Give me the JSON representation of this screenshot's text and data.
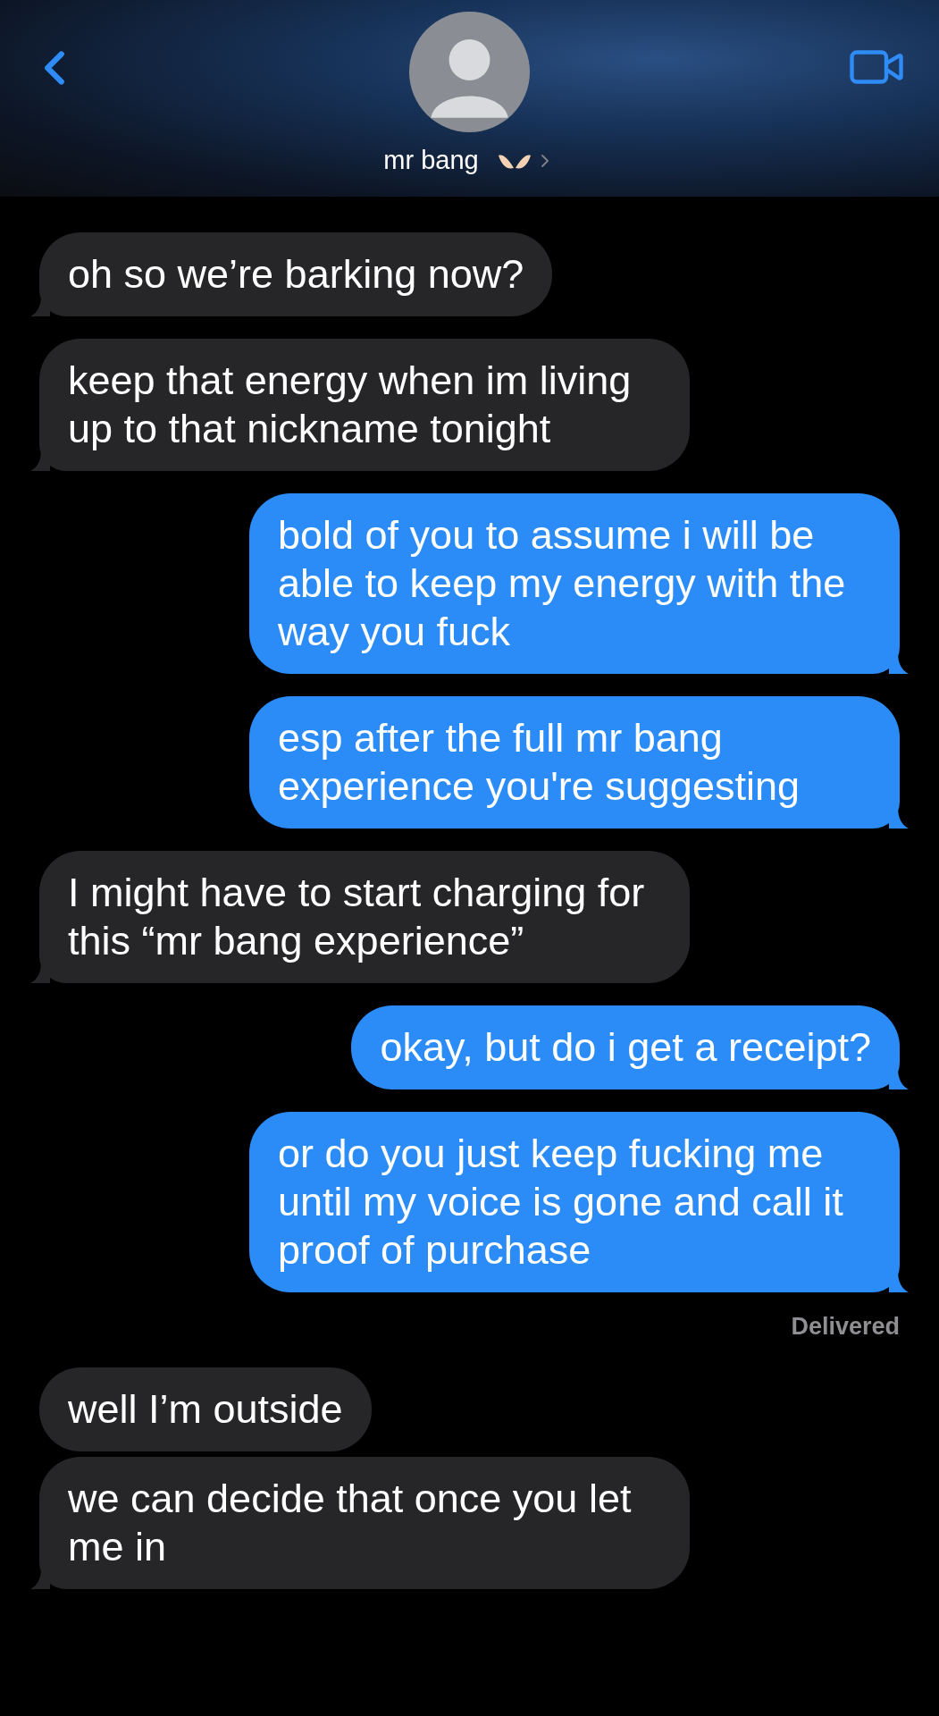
{
  "header": {
    "contact_name": "mr bang"
  },
  "messages": [
    {
      "kind": "incoming",
      "text": "oh so we’re barking now?",
      "tail": true
    },
    {
      "kind": "incoming",
      "text": "keep that energy when im living up to that nickname tonight",
      "tail": true
    },
    {
      "kind": "outgoing",
      "text": "bold of you to assume i will be able to keep my energy with the way you fuck",
      "tail": true
    },
    {
      "kind": "outgoing",
      "text": "esp after the full mr bang experience you're suggesting",
      "tail": true
    },
    {
      "kind": "incoming",
      "text": "I might have to start charging for this “mr bang experience”",
      "tail": true
    },
    {
      "kind": "outgoing",
      "text": "okay, but do i get a receipt?",
      "tail": true
    },
    {
      "kind": "outgoing",
      "text": "or do you just keep fucking me until my voice is gone and call it proof of purchase",
      "tail": true,
      "status": "Delivered"
    },
    {
      "kind": "incoming",
      "text": "well I’m outside",
      "tail": false
    },
    {
      "kind": "incoming",
      "text": "we can decide that once you let me in",
      "tail": true
    }
  ]
}
